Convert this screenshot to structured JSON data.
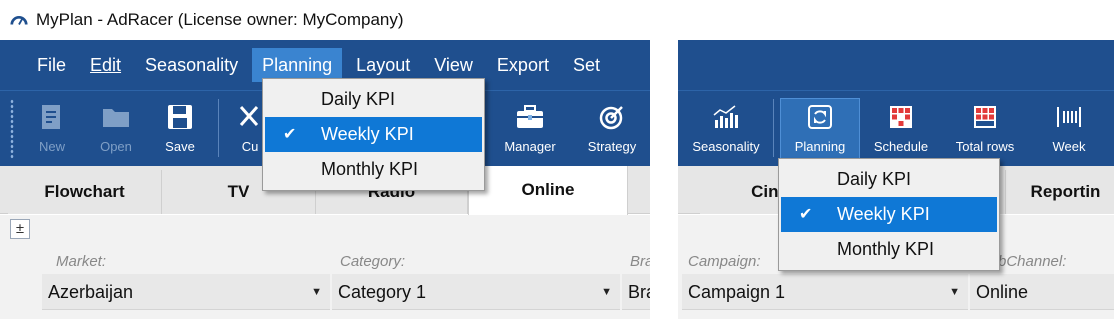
{
  "window": {
    "title": "MyPlan - AdRacer (License owner: MyCompany)"
  },
  "menubar": {
    "items": [
      {
        "label": "File"
      },
      {
        "label": "Edit"
      },
      {
        "label": "Seasonality"
      },
      {
        "label": "Planning"
      },
      {
        "label": "Layout"
      },
      {
        "label": "View"
      },
      {
        "label": "Export"
      },
      {
        "label": "Set"
      }
    ]
  },
  "toolbar_left": {
    "items": [
      {
        "label": "New",
        "icon": "new-document-icon",
        "enabled": false
      },
      {
        "label": "Open",
        "icon": "folder-icon",
        "enabled": false
      },
      {
        "label": "Save",
        "icon": "save-icon",
        "enabled": true
      },
      {
        "label": "Cu",
        "icon": "cut-icon",
        "enabled": true
      },
      {
        "label": "Manager",
        "icon": "briefcase-icon",
        "enabled": true
      },
      {
        "label": "Strategy",
        "icon": "target-icon",
        "enabled": true
      }
    ]
  },
  "toolbar_right": {
    "items": [
      {
        "label": "Seasonality",
        "icon": "bar-chart-icon"
      },
      {
        "label": "Planning",
        "icon": "planning-icon"
      },
      {
        "label": "Schedule",
        "icon": "schedule-grid-icon"
      },
      {
        "label": "Total rows",
        "icon": "total-rows-icon"
      },
      {
        "label": "Week",
        "icon": "week-icon"
      }
    ]
  },
  "tabs_left": [
    {
      "label": "Flowchart"
    },
    {
      "label": "TV"
    },
    {
      "label": "Radio"
    },
    {
      "label": "Online"
    }
  ],
  "tabs_right": [
    {
      "label": "Cine"
    },
    {
      "label": "Reportin"
    }
  ],
  "filters_left": {
    "expand_symbol": "±",
    "market": {
      "label": "Market:",
      "value": "Azerbaijan"
    },
    "category": {
      "label": "Category:",
      "value": "Category 1"
    },
    "brand": {
      "label": "Bra",
      "value": "Bra"
    }
  },
  "filters_right": {
    "campaign": {
      "label": "Campaign:",
      "value": "Campaign 1"
    },
    "subchannel": {
      "label": "bChannel:",
      "value": "Online"
    }
  },
  "planning_menu": {
    "items": [
      {
        "label": "Daily KPI",
        "checked": false
      },
      {
        "label": "Weekly KPI",
        "checked": true
      },
      {
        "label": "Monthly KPI",
        "checked": false
      }
    ],
    "check_glyph": "✔"
  },
  "colors": {
    "menubar_bg": "#1f4f8e",
    "menu_active": "#3a84d0",
    "selection": "#0f78d6"
  }
}
